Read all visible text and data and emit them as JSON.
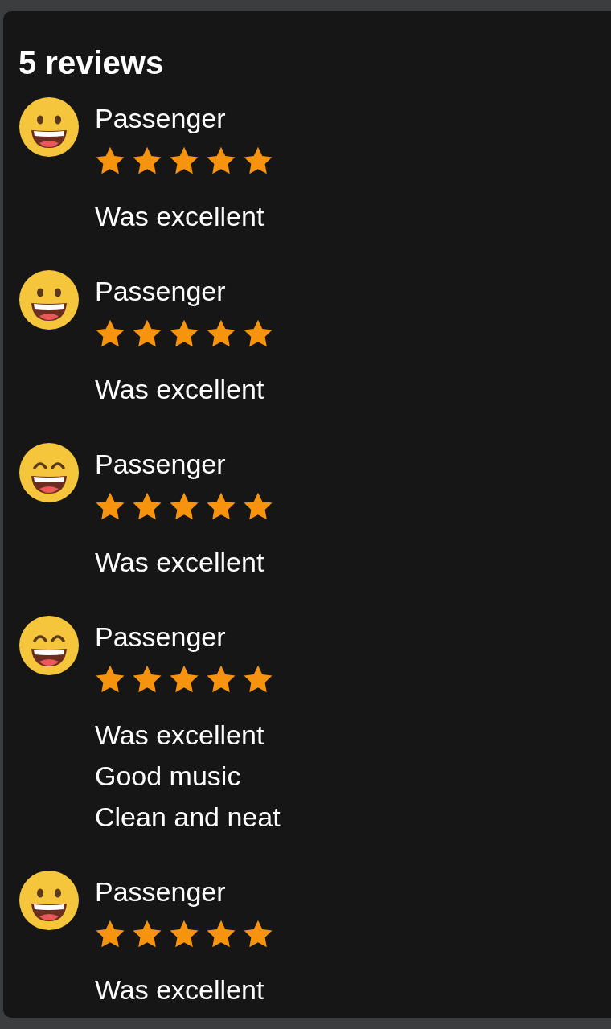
{
  "title": "5 reviews",
  "reviews": [
    {
      "avatar": {
        "kind": "grin"
      },
      "name": "Passenger",
      "stars": 5,
      "comments": [
        "Was excellent"
      ]
    },
    {
      "avatar": {
        "kind": "grin"
      },
      "name": "Passenger",
      "stars": 5,
      "comments": [
        "Was excellent"
      ]
    },
    {
      "avatar": {
        "kind": "beam"
      },
      "name": "Passenger",
      "stars": 5,
      "comments": [
        "Was excellent"
      ]
    },
    {
      "avatar": {
        "kind": "beam"
      },
      "name": "Passenger",
      "stars": 5,
      "comments": [
        "Was excellent",
        "Good music",
        "Clean and neat"
      ]
    },
    {
      "avatar": {
        "kind": "grin"
      },
      "name": "Passenger",
      "stars": 5,
      "comments": [
        "Was excellent"
      ]
    }
  ]
}
